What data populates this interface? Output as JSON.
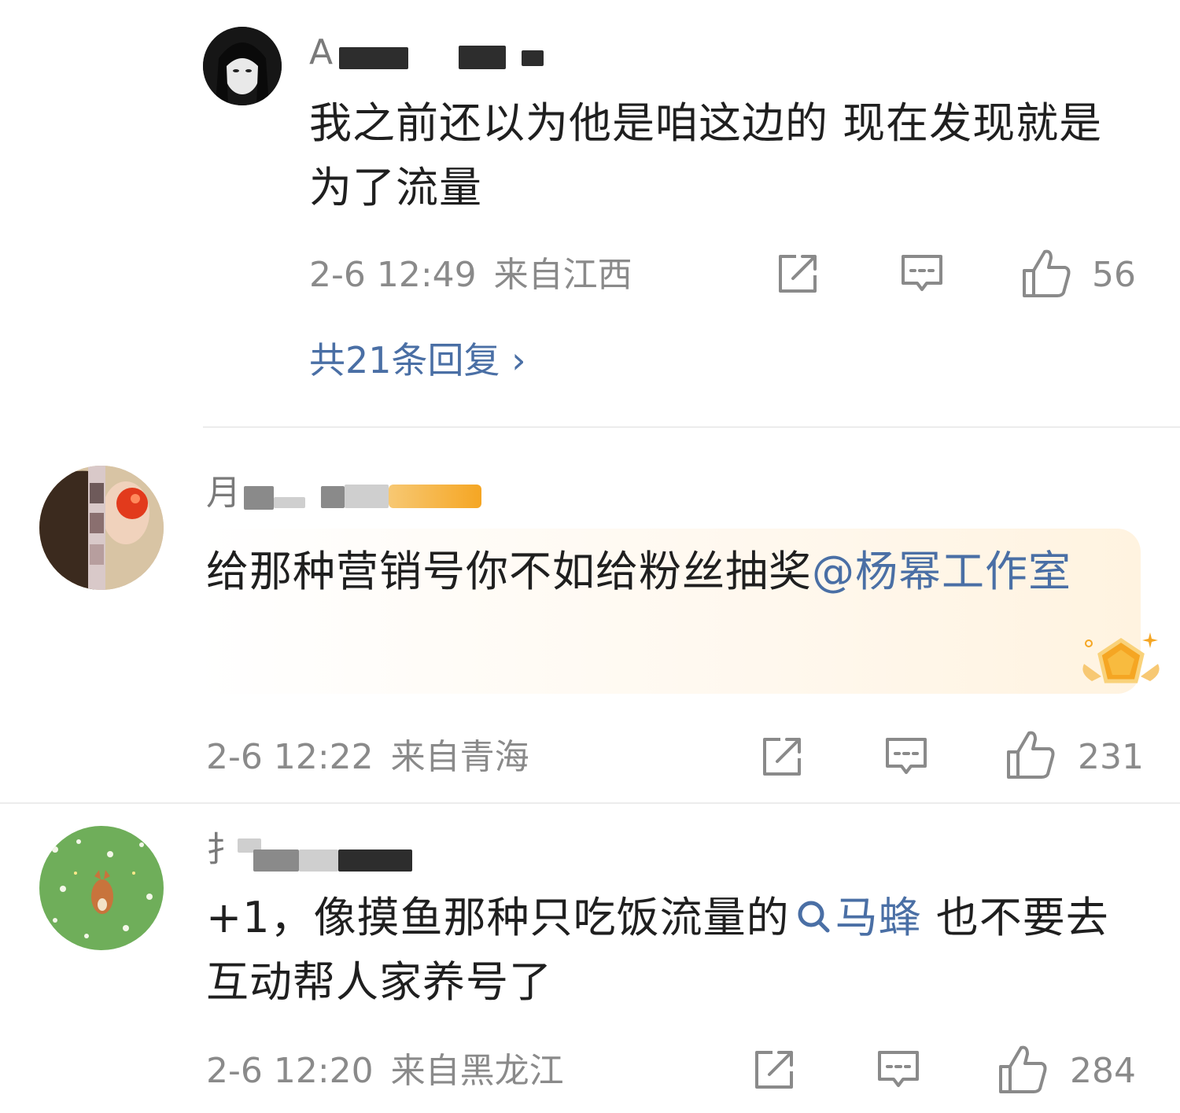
{
  "comments": [
    {
      "username": "A",
      "text": "我之前还以为他是咱这边的 现在发现就是为了流量",
      "time": "2-6 12:49",
      "location": "来自江西",
      "likes": "56",
      "replies_label": "共21条回复 ›"
    },
    {
      "username": "月",
      "text_before": "给那种营销号你不如给粉丝抽奖",
      "mention": "@杨幂工作室",
      "time": "2-6 12:22",
      "location": "来自青海",
      "likes": "231"
    },
    {
      "username": "扌",
      "text_before": "+1，像摸鱼那种只吃饭流量的",
      "topic": "马蜂",
      "text_after": " 也不要去互动帮人家养号了",
      "time": "2-6 12:20",
      "location": "来自黑龙江",
      "likes": "284"
    }
  ],
  "icons": {
    "share": "share-icon",
    "comment": "comment-icon",
    "like": "thumbs-up-icon",
    "search": "search-icon",
    "badge": "gold-badge-icon"
  },
  "colors": {
    "link": "#4a6fa5",
    "meta": "#8a8a8a",
    "text": "#1f1f1f"
  }
}
